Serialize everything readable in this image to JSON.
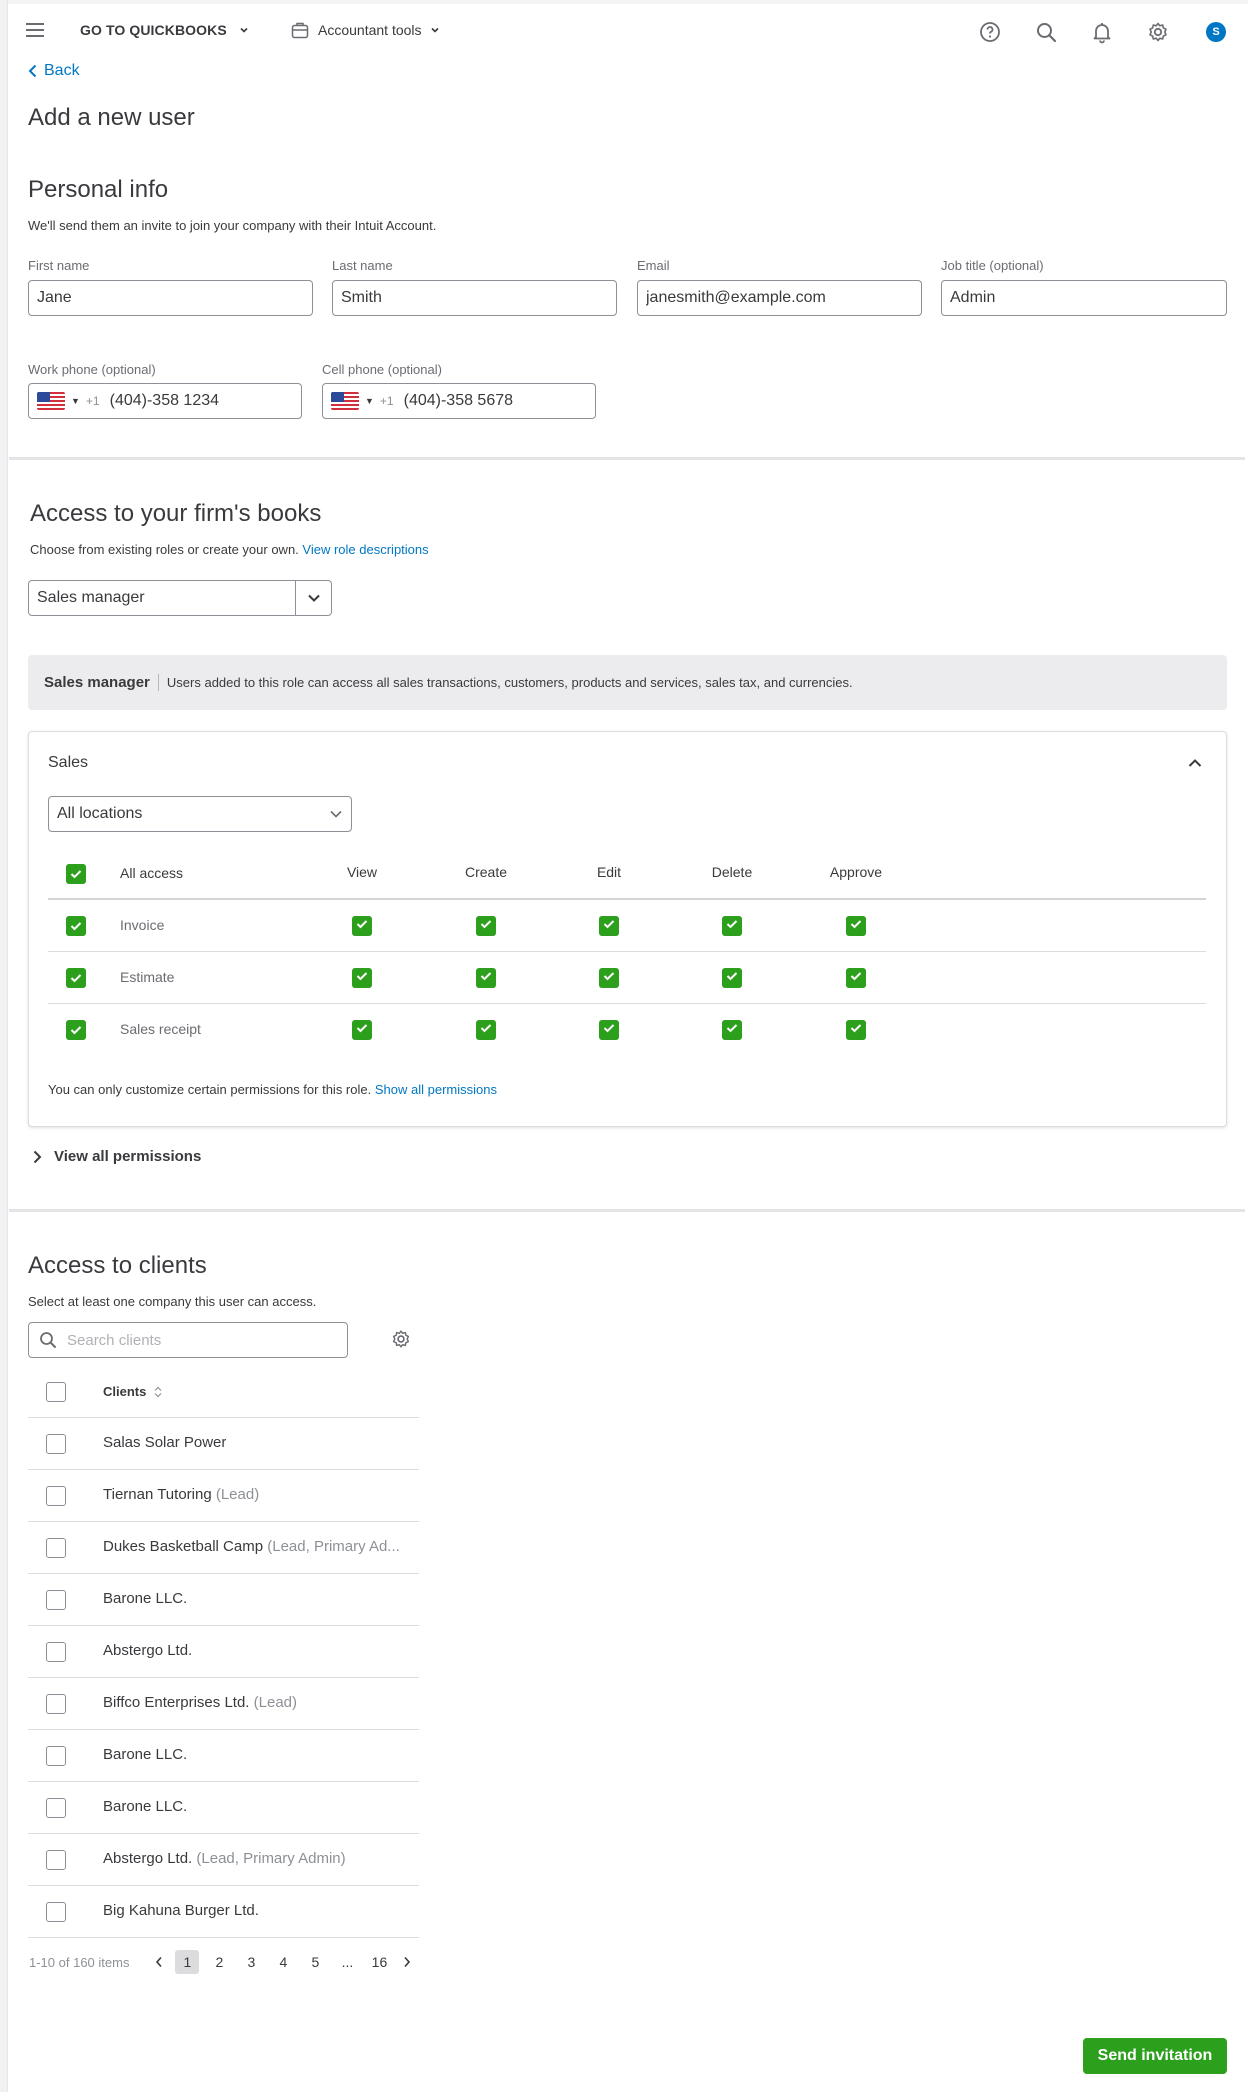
{
  "topbar": {
    "go_to_quickbooks": "GO TO QUICKBOOKS",
    "accountant_tools": "Accountant tools",
    "avatar_initial": "S",
    "icons": [
      "menu-icon",
      "help-icon",
      "search-icon",
      "bell-icon",
      "gear-icon"
    ]
  },
  "nav": {
    "back_label": "Back"
  },
  "page": {
    "title": "Add a new user"
  },
  "personal_info": {
    "title": "Personal info",
    "subtitle": "We'll send them an invite to join your company with their Intuit Account.",
    "first_name": {
      "label": "First name",
      "value": "Jane"
    },
    "last_name": {
      "label": "Last name",
      "value": "Smith"
    },
    "email": {
      "label": "Email",
      "value": "janesmith@example.com"
    },
    "job_title": {
      "label": "Job title (optional)",
      "value": "Admin"
    },
    "work_phone": {
      "label": "Work phone (optional)",
      "country_code": "+1",
      "value": "(404)-358 1234"
    },
    "cell_phone": {
      "label": "Cell phone (optional)",
      "country_code": "+1",
      "value": "(404)-358 5678"
    }
  },
  "firm_access": {
    "title": "Access to your firm's books",
    "subtitle": "Choose from existing roles or create your own.",
    "subtitle_link": "View role descriptions",
    "role_selected": "Sales manager",
    "banner": {
      "role_name": "Sales manager",
      "description": "Users added to this role can access all sales transactions, customers, products and services, sales tax, and currencies."
    },
    "card": {
      "title": "Sales",
      "location_selected": "All locations",
      "columns": [
        "All access",
        "View",
        "Create",
        "Edit",
        "Delete",
        "Approve"
      ],
      "rows": [
        {
          "label": "Invoice",
          "all": true,
          "view": true,
          "create": true,
          "edit": true,
          "delete": true,
          "approve": true
        },
        {
          "label": "Estimate",
          "all": true,
          "view": true,
          "create": true,
          "edit": true,
          "delete": true,
          "approve": true
        },
        {
          "label": "Sales receipt",
          "all": true,
          "view": true,
          "create": true,
          "edit": true,
          "delete": true,
          "approve": true
        }
      ],
      "all_access_checked": true,
      "note": "You can only customize certain permissions for this role.",
      "note_link": "Show all permissions"
    },
    "view_all_permissions": "View all permissions"
  },
  "client_access": {
    "title": "Access to clients",
    "subtitle": "Select at least one company this user can access.",
    "search_placeholder": "Search clients",
    "column_header": "Clients",
    "clients": [
      {
        "name": "Salas Solar Power",
        "tag": ""
      },
      {
        "name": "Tiernan Tutoring",
        "tag": "(Lead)"
      },
      {
        "name": "Dukes Basketball Camp",
        "tag": "(Lead, Primary Ad..."
      },
      {
        "name": "Barone LLC.",
        "tag": ""
      },
      {
        "name": "Abstergo Ltd.",
        "tag": ""
      },
      {
        "name": "Biffco Enterprises Ltd.",
        "tag": " (Lead)"
      },
      {
        "name": "Barone LLC.",
        "tag": ""
      },
      {
        "name": "Barone LLC.",
        "tag": ""
      },
      {
        "name": "Abstergo Ltd.",
        "tag": " (Lead, Primary Admin)"
      },
      {
        "name": "Big Kahuna Burger Ltd.",
        "tag": ""
      }
    ],
    "pagination": {
      "summary": "1-10 of 160 items",
      "pages": [
        "1",
        "2",
        "3",
        "4",
        "5",
        "...",
        "16"
      ],
      "current": "1"
    }
  },
  "footer": {
    "send_invitation": "Send invitation"
  },
  "colors": {
    "brand_green": "#2ca01c",
    "link_blue": "#0077c5",
    "text": "#393a3d"
  }
}
